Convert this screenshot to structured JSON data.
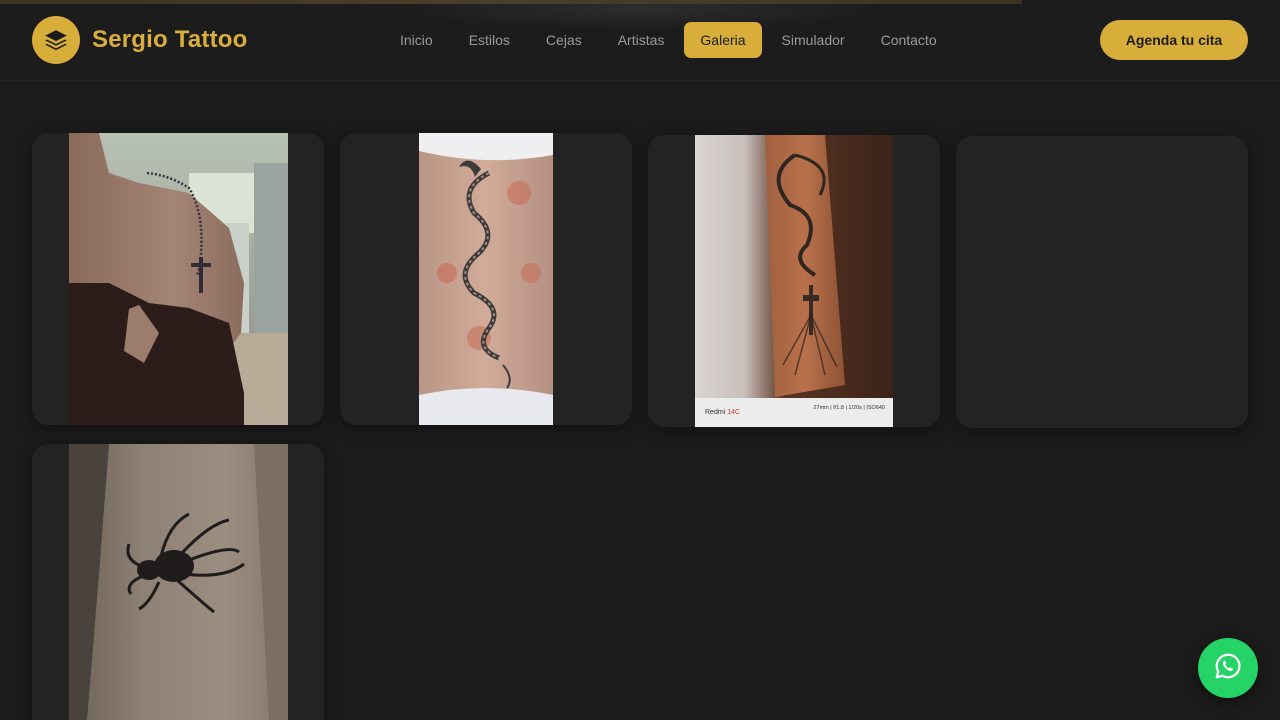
{
  "brand": {
    "name": "Sergio Tattoo",
    "logo_icon": "layers-icon",
    "accent": "#d7ae3a"
  },
  "nav": {
    "items": [
      {
        "label": "Inicio",
        "active": false
      },
      {
        "label": "Estilos",
        "active": false
      },
      {
        "label": "Cejas",
        "active": false
      },
      {
        "label": "Artistas",
        "active": false
      },
      {
        "label": "Galeria",
        "active": true
      },
      {
        "label": "Simulador",
        "active": false
      },
      {
        "label": "Contacto",
        "active": false
      }
    ]
  },
  "cta": {
    "label": "Agenda tu cita"
  },
  "gallery": {
    "items": [
      {
        "subject": "rosary-cross-shoulder-tattoo"
      },
      {
        "subject": "dragon-back-tattoo"
      },
      {
        "subject": "dove-cross-forearm-tattoo",
        "caption_brand": "Redmi",
        "caption_model": "14C",
        "caption_specs": "27mm | f/1.8 | 1/20s | ISO640"
      },
      {
        "subject": "empty-placeholder"
      },
      {
        "subject": "spider-side-tattoo"
      }
    ]
  },
  "whatsapp": {
    "icon": "whatsapp-icon",
    "color": "#25d366"
  }
}
